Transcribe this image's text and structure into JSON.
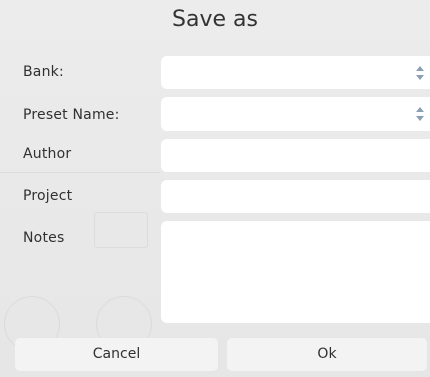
{
  "dialog": {
    "title": "Save as"
  },
  "form": {
    "bank_label": "Bank:",
    "bank_value": "",
    "preset_name_label": "Preset Name:",
    "preset_name_value": "",
    "author_label": "Author",
    "author_value": "",
    "project_label": "Project",
    "project_value": "",
    "notes_label": "Notes",
    "notes_value": ""
  },
  "buttons": {
    "cancel_label": "Cancel",
    "ok_label": "Ok"
  }
}
